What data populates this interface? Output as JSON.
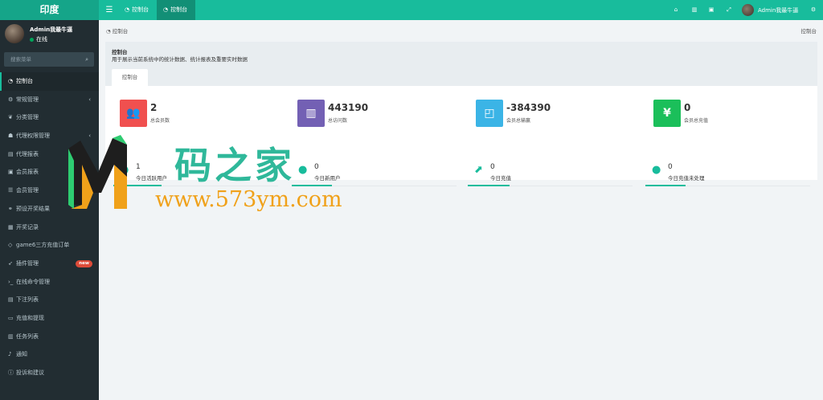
{
  "app": {
    "logo_text": "印度"
  },
  "topbar": {
    "tabs": [
      {
        "label": "控制台",
        "icon": "dashboard-icon"
      },
      {
        "label": "控制台",
        "icon": "dashboard-icon"
      }
    ],
    "right_icons": [
      "home-icon",
      "trash-icon",
      "translate-icon",
      "fullscreen-icon"
    ],
    "user_name": "Admin我最牛逼"
  },
  "sidebar": {
    "user": {
      "name": "Admin我最牛逼",
      "status": "在线"
    },
    "search_placeholder": "搜索菜单",
    "items": [
      {
        "label": "控制台",
        "icon": "dashboard-icon",
        "active": true
      },
      {
        "label": "常规管理",
        "icon": "cogs-icon",
        "chevron": true
      },
      {
        "label": "分类管理",
        "icon": "leaf-icon"
      },
      {
        "label": "代理权限管理",
        "icon": "group-icon",
        "chevron": true
      },
      {
        "label": "代理报表",
        "icon": "folder-icon"
      },
      {
        "label": "会员报表",
        "icon": "user-square-icon"
      },
      {
        "label": "会员管理",
        "icon": "list-icon"
      },
      {
        "label": "预设开奖结果",
        "icon": "link-icon"
      },
      {
        "label": "开奖记录",
        "icon": "calendar-icon"
      },
      {
        "label": "game6三方充值订单",
        "icon": "diamond-icon"
      },
      {
        "label": "插件管理",
        "icon": "rocket-icon",
        "badge": "new"
      },
      {
        "label": "在线命令管理",
        "icon": "terminal-icon"
      },
      {
        "label": "下注列表",
        "icon": "list-alt-icon"
      },
      {
        "label": "充值和提现",
        "icon": "money-icon"
      },
      {
        "label": "任务列表",
        "icon": "book-icon"
      },
      {
        "label": "通知",
        "icon": "bell-icon"
      },
      {
        "label": "投诉和建议",
        "icon": "info-circle-icon"
      }
    ]
  },
  "content": {
    "breadcrumb": "控制台",
    "breadcrumb_right": "控制台",
    "panel_title": "控制台",
    "panel_desc": "用于展示当前系统中的统计数据、统计报表及重要实时数据",
    "panel_tab": "控制台",
    "stats": [
      {
        "value": "2",
        "label": "总会员数",
        "color": "#f0504f",
        "icon": "users-icon"
      },
      {
        "value": "443190",
        "label": "总访问数",
        "color": "#7360b4",
        "icon": "book-icon"
      },
      {
        "value": "-384390",
        "label": "会员总输赢",
        "color": "#3bb4e6",
        "icon": "shopping-bag-icon"
      },
      {
        "value": "0",
        "label": "会员总充值",
        "color": "#1bbf5a",
        "icon": "yen-icon"
      }
    ],
    "minis": [
      {
        "value": "1",
        "label": "今日活跃用户",
        "icon": "user-icon"
      },
      {
        "value": "0",
        "label": "今日新用户",
        "icon": "user-plus-icon"
      },
      {
        "value": "0",
        "label": "今日充值",
        "icon": "line-chart-icon"
      },
      {
        "value": "0",
        "label": "今日充值未处理",
        "icon": "users-icon"
      }
    ]
  },
  "watermark": {
    "text": "码之家",
    "url": "www.573ym.com"
  }
}
